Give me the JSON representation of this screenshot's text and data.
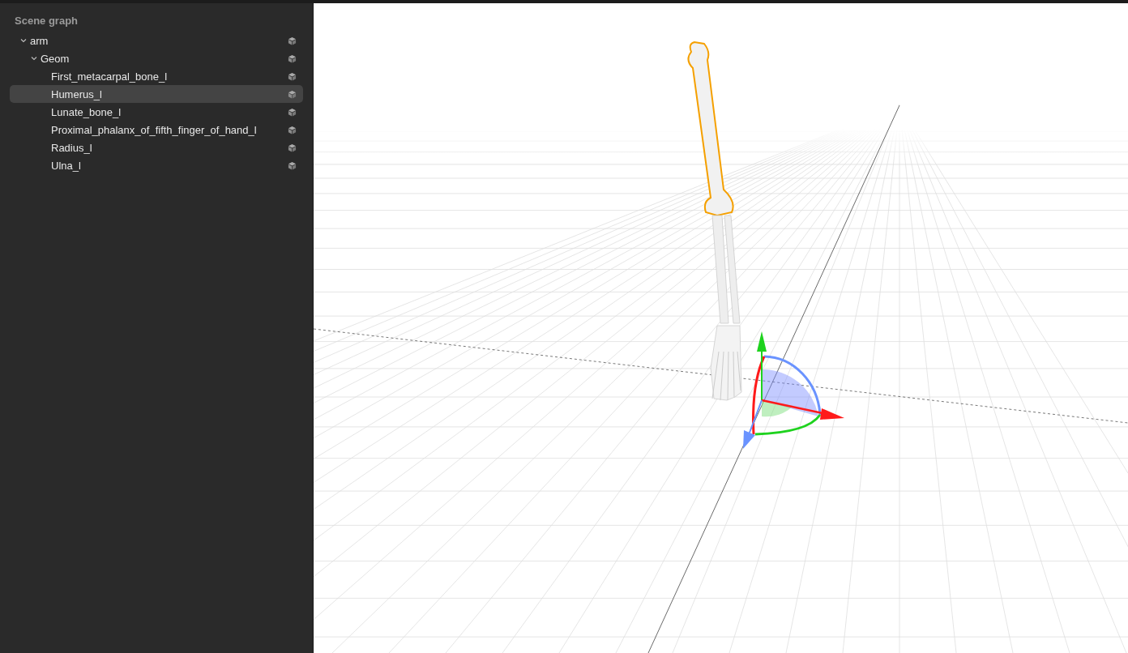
{
  "panel": {
    "title": "Scene graph"
  },
  "tree": [
    {
      "name": "arm",
      "expanded": true,
      "selected": false,
      "children": [
        {
          "name": "Geom",
          "expanded": true,
          "selected": false,
          "children": [
            {
              "name": "First_metacarpal_bone_l",
              "selected": false
            },
            {
              "name": "Humerus_l",
              "selected": true
            },
            {
              "name": "Lunate_bone_l",
              "selected": false
            },
            {
              "name": "Proximal_phalanx_of_fifth_finger_of_hand_l",
              "selected": false
            },
            {
              "name": "Radius_l",
              "selected": false
            },
            {
              "name": "Ulna_l",
              "selected": false
            }
          ]
        }
      ]
    }
  ]
}
